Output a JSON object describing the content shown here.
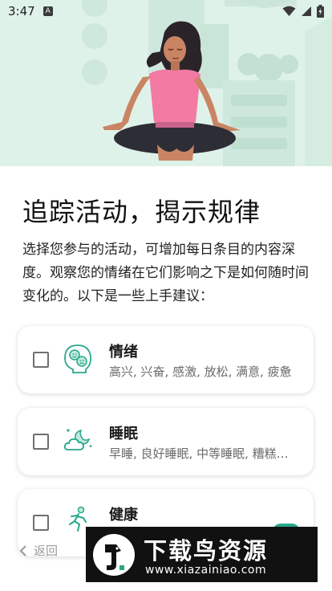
{
  "status_bar": {
    "time": "3:47",
    "notification_icon_label": "A",
    "icons": [
      "wifi-icon",
      "signal-icon",
      "battery-icon"
    ]
  },
  "hero": {
    "illustration": "meditating-woman-illustration",
    "colors": {
      "background": "#dff2ea",
      "shirt": "#f27aa3",
      "pants": "#2d2d35",
      "skin": "#c98563"
    }
  },
  "main": {
    "title": "追踪活动，揭示规律",
    "description": "选择您参与的活动，可增加每日条目的内容深度。观察您的情绪在它们影响之下是如何随时间变化的。以下是一些上手建议："
  },
  "cards": [
    {
      "title": "情绪",
      "subtitle": "高兴, 兴奋, 感激, 放松, 满意, 疲惫",
      "icon": "mood-faces-icon",
      "checked": false
    },
    {
      "title": "睡眠",
      "subtitle": "早睡, 良好睡眠, 中等睡眠, 糟糕睡眠",
      "icon": "sleep-moon-cloud-icon",
      "checked": false
    },
    {
      "title": "健康",
      "subtitle": "",
      "icon": "running-person-icon",
      "checked": false
    }
  ],
  "nav": {
    "back_label": "返回"
  },
  "watermark": {
    "title": "下载鸟资源",
    "url": "www.xiazainiao.com"
  },
  "colors": {
    "accent": "#27a88a",
    "text": "#1f1f1f",
    "muted": "#6b6b6b"
  }
}
